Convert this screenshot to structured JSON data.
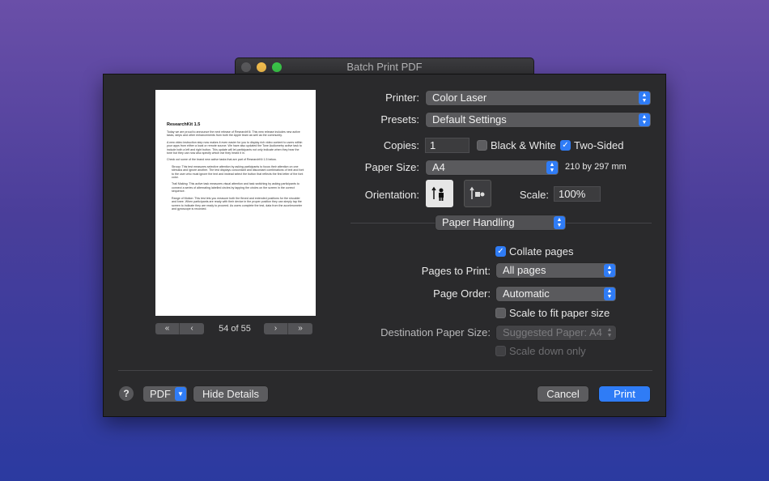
{
  "window": {
    "title": "Batch Print PDF"
  },
  "preview": {
    "doc_title": "ResearchKit 1.5",
    "paragraphs": [
      "Today we are proud to announce the next release of ResearchKit. This new release includes new active tasks, steps and other enhancements from both the Apple team as well as the community.",
      "A new video instruction step now makes it even easier for you to display rich video content to users within your apps from either a local or remote source. We have also updated the Tone Audiometry active task to include both a left and right button. This update will let participants not only indicate when they hear the tone but they can now also specify which ear they heard it in.",
      "Check out some of the brand new active tasks that are part of ResearchKit 1.5 below.",
      "Stroop: This test measures selective attention by asking participants to focus their attention on one stimulus and ignore another. The test displays concordant and discordant combinations of text and font to the user who must ignore the text and instead select the button that reflects the first letter of the font color.",
      "Trail Making: This active task measures visual attention and task switching by asking participants to connect a series of alternating labelled circles by tapping the circles on the screen in the correct sequence.",
      "Range of Motion: This test lets you measure both the flexed and extended positions for the shoulder and knee. When participants are ready with their device in the proper position they can simply tap the screen to indicate they are ready to proceed. As users complete the test, data from the accelerometer and gyroscope is recorded."
    ],
    "first_label": "«",
    "prev_label": "‹",
    "next_label": "›",
    "last_label": "»",
    "page_count": "54 of 55"
  },
  "form": {
    "printer_label": "Printer:",
    "printer_value": "Color Laser",
    "presets_label": "Presets:",
    "presets_value": "Default Settings",
    "copies_label": "Copies:",
    "copies_value": "1",
    "bw_label": "Black & White",
    "bw_checked": false,
    "two_sided_label": "Two-Sided",
    "two_sided_checked": true,
    "paper_size_label": "Paper Size:",
    "paper_size_value": "A4",
    "paper_dims": "210 by 297 mm",
    "orientation_label": "Orientation:",
    "scale_label": "Scale:",
    "scale_value": "100%",
    "section_value": "Paper Handling",
    "collate_label": "Collate pages",
    "collate_checked": true,
    "pages_to_print_label": "Pages to Print:",
    "pages_to_print_value": "All pages",
    "page_order_label": "Page Order:",
    "page_order_value": "Automatic",
    "scale_fit_label": "Scale to fit paper size",
    "scale_fit_checked": false,
    "dest_paper_label": "Destination Paper Size:",
    "dest_paper_value": "Suggested Paper: A4",
    "scale_down_label": "Scale down only"
  },
  "footer": {
    "help_label": "?",
    "pdf_label": "PDF",
    "hide_details_label": "Hide Details",
    "cancel_label": "Cancel",
    "print_label": "Print"
  },
  "colors": {
    "accent": "#2f7cf6",
    "panel": "#2a2a2c"
  }
}
